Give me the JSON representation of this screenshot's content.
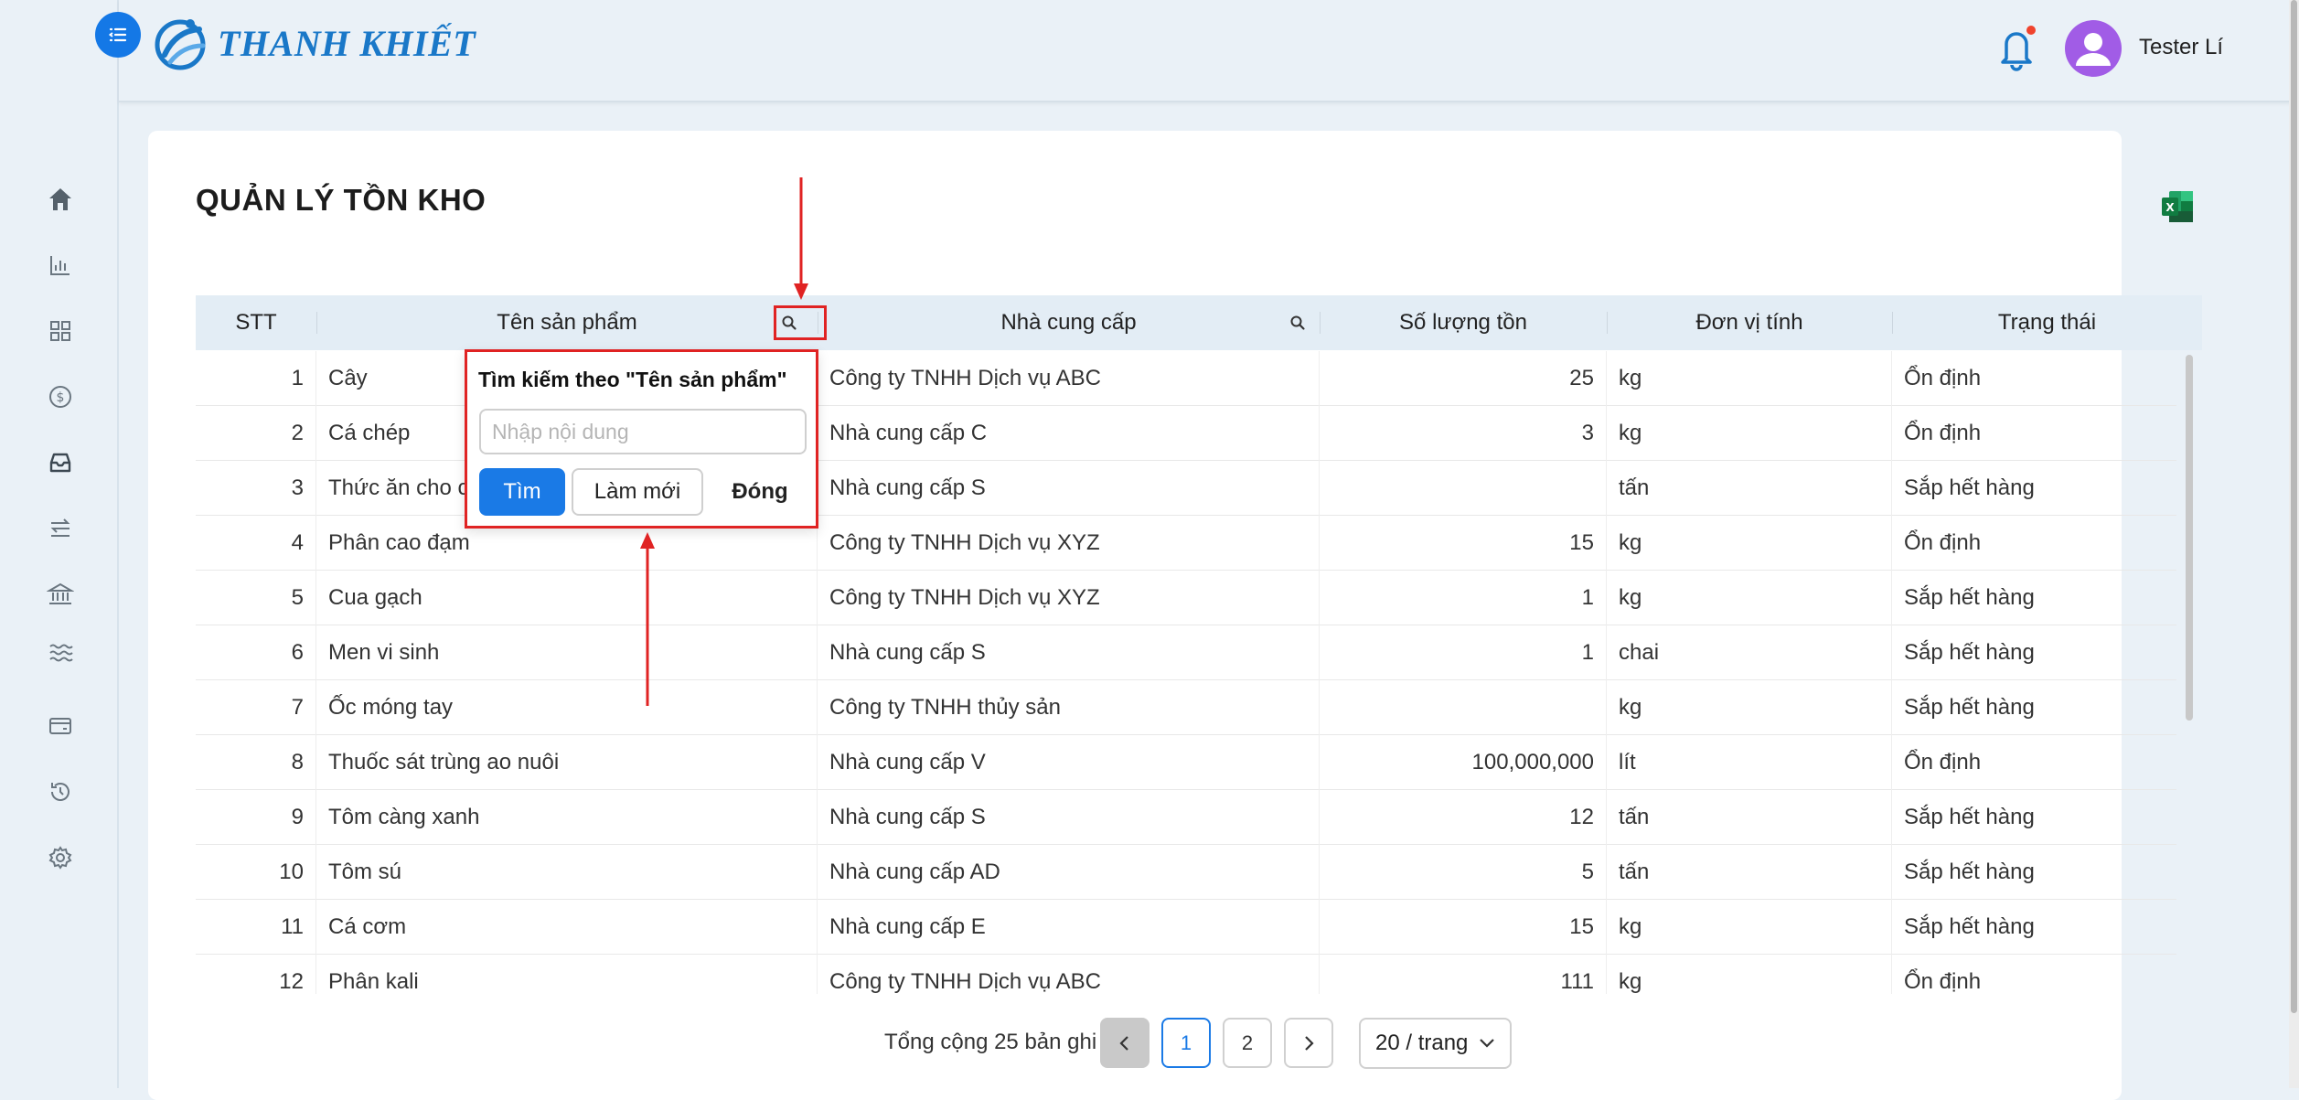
{
  "app": {
    "logo_text": "THANH KHIẾT",
    "username": "Tester Lí"
  },
  "sidebar": {
    "icons": [
      "home-icon",
      "bar-chart-icon",
      "grid-icon",
      "dollar-icon",
      "inbox-icon",
      "transfer-icon",
      "bank-icon",
      "waves-icon",
      "card-icon",
      "history-icon",
      "gear-icon"
    ]
  },
  "page": {
    "title": "QUẢN LÝ TỒN KHO"
  },
  "table": {
    "headers": {
      "stt": "STT",
      "name": "Tên sản phẩm",
      "supplier": "Nhà cung cấp",
      "qty": "Số lượng tồn",
      "unit": "Đơn vị tính",
      "status": "Trạng thái"
    },
    "rows": [
      {
        "stt": "1",
        "name": "Cây",
        "supplier": "Công ty TNHH Dịch vụ ABC",
        "qty": "25",
        "unit": "kg",
        "status": "Ổn định"
      },
      {
        "stt": "2",
        "name": "Cá chép",
        "supplier": "Nhà cung cấp C",
        "qty": "3",
        "unit": "kg",
        "status": "Ổn định"
      },
      {
        "stt": "3",
        "name": "Thức ăn cho cá",
        "supplier": "Nhà cung cấp S",
        "qty": "",
        "unit": "tấn",
        "status": "Sắp hết hàng"
      },
      {
        "stt": "4",
        "name": "Phân cao đạm",
        "supplier": "Công ty TNHH Dịch vụ XYZ",
        "qty": "15",
        "unit": "kg",
        "status": "Ổn định"
      },
      {
        "stt": "5",
        "name": "Cua gạch",
        "supplier": "Công ty TNHH Dịch vụ XYZ",
        "qty": "1",
        "unit": "kg",
        "status": "Sắp hết hàng"
      },
      {
        "stt": "6",
        "name": "Men vi sinh",
        "supplier": "Nhà cung cấp S",
        "qty": "1",
        "unit": "chai",
        "status": "Sắp hết hàng"
      },
      {
        "stt": "7",
        "name": "Ốc móng tay",
        "supplier": "Công ty TNHH thủy sản",
        "qty": "",
        "unit": "kg",
        "status": "Sắp hết hàng"
      },
      {
        "stt": "8",
        "name": "Thuốc sát trùng ao nuôi",
        "supplier": "Nhà cung cấp V",
        "qty": "100,000,000",
        "unit": "lít",
        "status": "Ổn định"
      },
      {
        "stt": "9",
        "name": "Tôm càng xanh",
        "supplier": "Nhà cung cấp S",
        "qty": "12",
        "unit": "tấn",
        "status": "Sắp hết hàng"
      },
      {
        "stt": "10",
        "name": "Tôm sú",
        "supplier": "Nhà cung cấp AD",
        "qty": "5",
        "unit": "tấn",
        "status": "Sắp hết hàng"
      },
      {
        "stt": "11",
        "name": "Cá cơm",
        "supplier": "Nhà cung cấp E",
        "qty": "15",
        "unit": "kg",
        "status": "Sắp hết hàng"
      },
      {
        "stt": "12",
        "name": "Phân kali",
        "supplier": "Công ty TNHH Dịch vụ ABC",
        "qty": "111",
        "unit": "kg",
        "status": "Ổn định"
      }
    ]
  },
  "search_popup": {
    "title": "Tìm kiếm theo \"Tên sản phẩm\"",
    "placeholder": "Nhập nội dung",
    "value": "",
    "find_label": "Tìm",
    "reset_label": "Làm mới",
    "close_label": "Đóng"
  },
  "pagination": {
    "total_text": "Tổng cộng 25 bản ghi",
    "pages": [
      "1",
      "2"
    ],
    "current_page": "1",
    "page_size": "20 / trang"
  },
  "colors": {
    "primary": "#1a7ae6",
    "highlight": "#e02323",
    "header_bg": "#e3edf5"
  }
}
